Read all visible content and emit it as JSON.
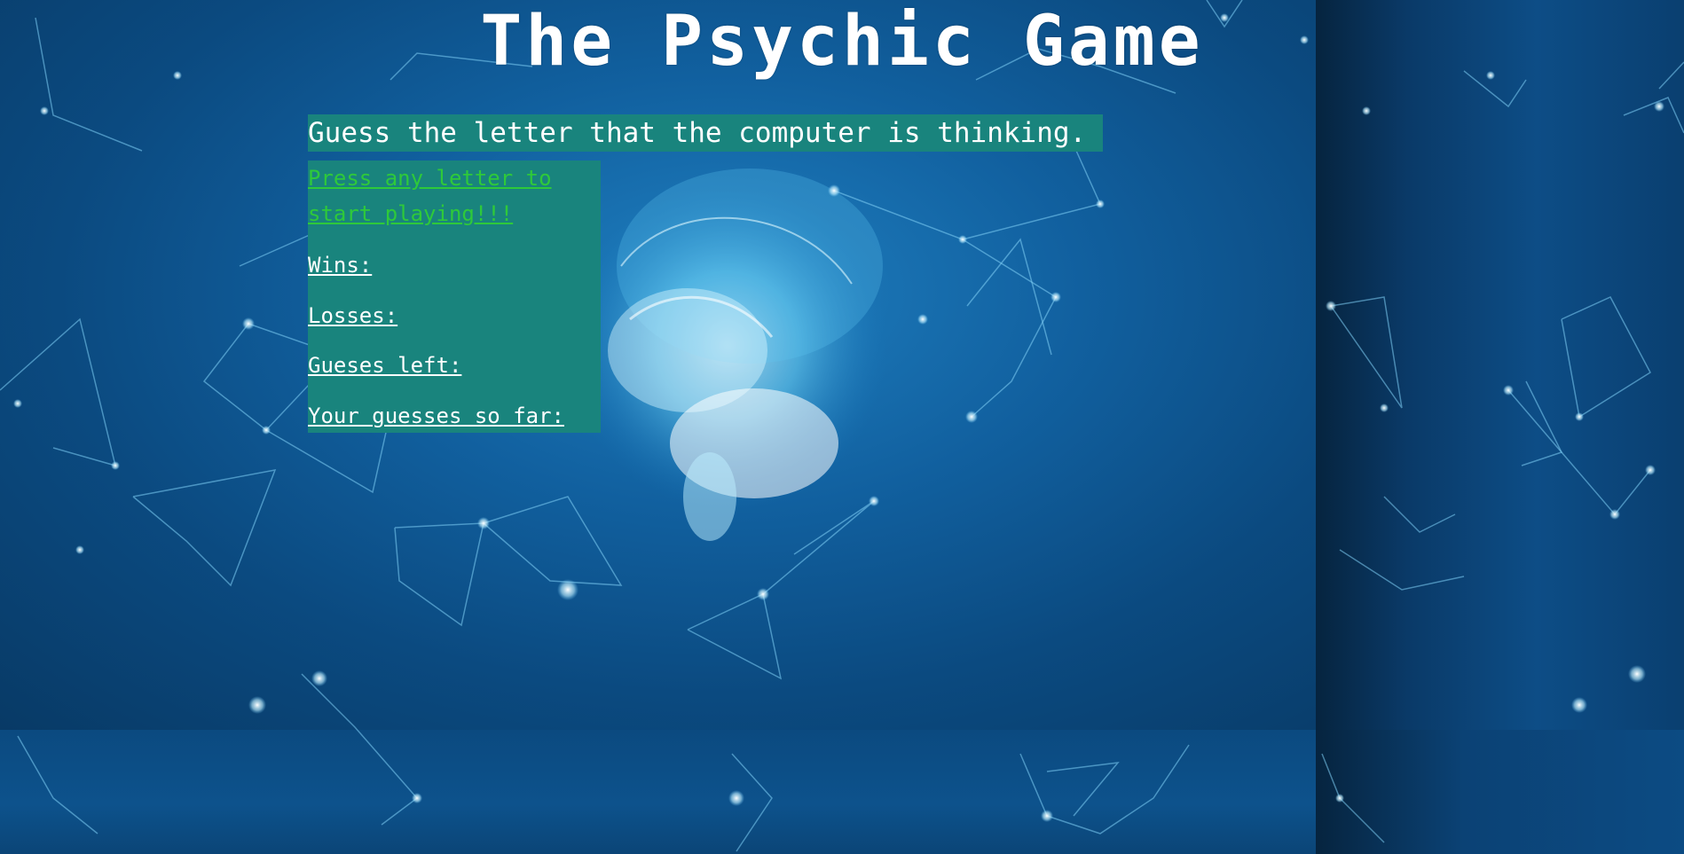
{
  "game": {
    "title": "The Psychic Game",
    "subtitle": "Guess the letter that the computer is thinking.",
    "start_prompt": "Press any letter to start playing!!!",
    "wins_label": "Wins:",
    "losses_label": "Losses:",
    "guesses_left_label": "Gueses left:",
    "guesses_so_far_label": "Your guesses so far:"
  },
  "colors": {
    "panel_bg": "#19847d",
    "start_prompt": "#2ec93a",
    "text": "#ffffff",
    "background": "#0b4a80"
  }
}
